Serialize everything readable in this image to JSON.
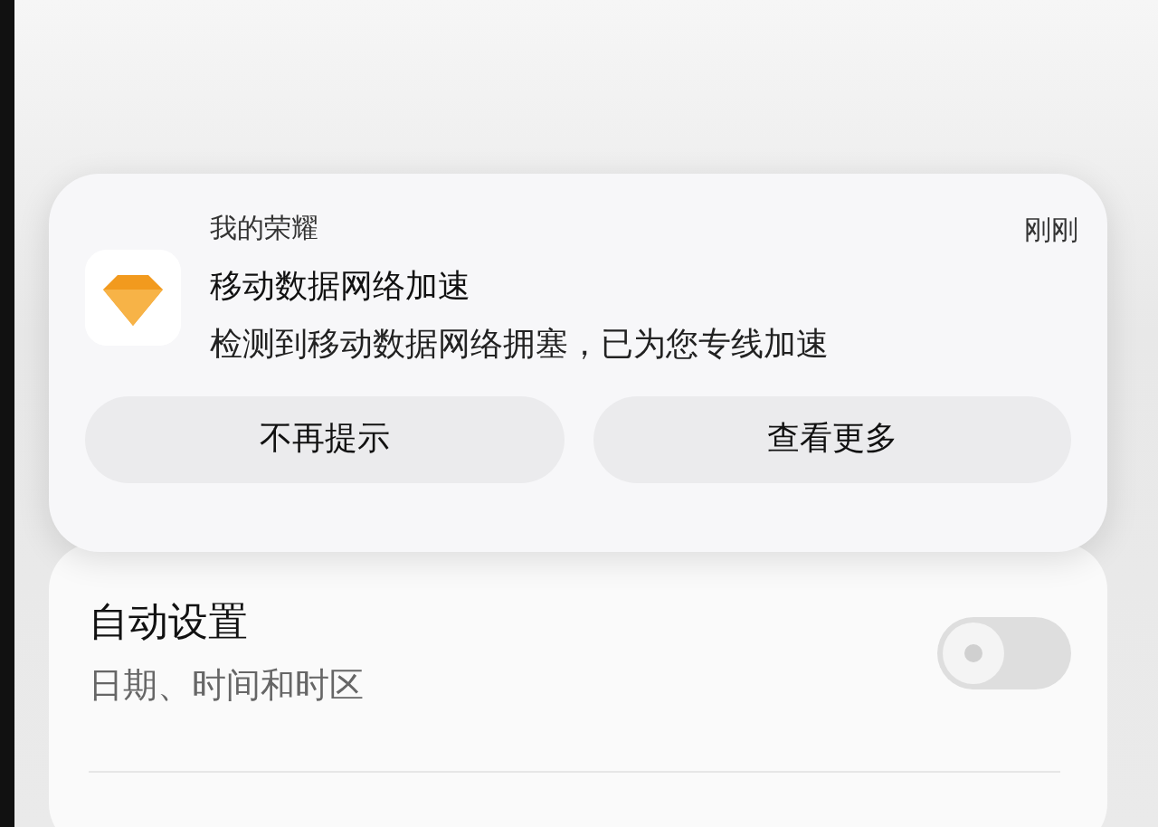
{
  "notification": {
    "app_name": "我的荣耀",
    "time": "刚刚",
    "title": "移动数据网络加速",
    "body": "检测到移动数据网络拥塞，已为您专线加速",
    "buttons": [
      "不再提示",
      "查看更多"
    ]
  },
  "settings": {
    "items": [
      {
        "title": "自动设置",
        "subtitle": "日期、时间和时区",
        "on": false
      }
    ]
  }
}
